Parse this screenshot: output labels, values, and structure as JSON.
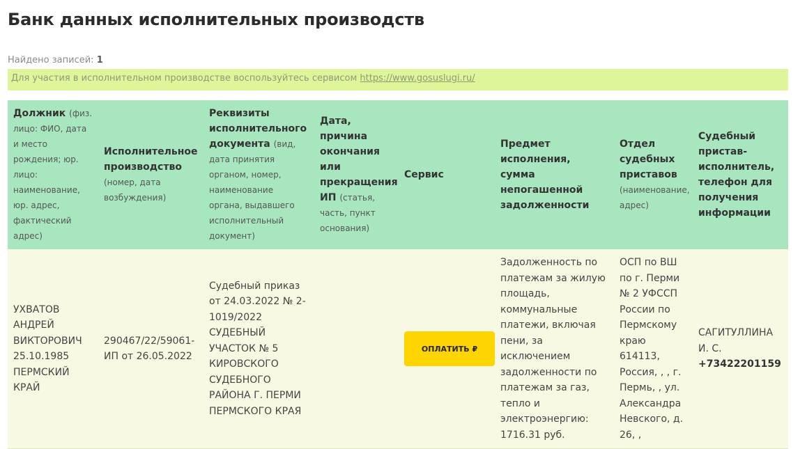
{
  "page": {
    "title": "Банк данных исполнительных производств"
  },
  "results": {
    "found_label": "Найдено записей:",
    "found_count": "1"
  },
  "notice": {
    "text": "Для участия в исполнительном производстве воспользуйтесь сервисом",
    "link": "https://www.gosuslugi.ru/"
  },
  "table": {
    "headers": [
      {
        "title": "Должник",
        "sub": "(физ. лицо: ФИО, дата и место рождения; юр. лицо: наименование, юр. адрес, фактический адрес)"
      },
      {
        "title": "Исполнительное производство",
        "sub": "(номер, дата возбуждения)"
      },
      {
        "title": "Реквизиты исполнительного документа",
        "sub": "(вид, дата принятия органом, номер, наименование органа, выдавшего исполнительный документ)"
      },
      {
        "title": "Дата, причина окончания или прекращения ИП",
        "sub": "(статья, часть, пункт основания)"
      },
      {
        "title": "Сервис",
        "sub": ""
      },
      {
        "title": "Предмет исполнения, сумма непогашенной задолженности",
        "sub": ""
      },
      {
        "title": "Отдел судебных приставов",
        "sub": "(наименование, адрес)"
      },
      {
        "title": "Судебный пристав-исполнитель, телефон для получения информации",
        "sub": ""
      }
    ],
    "row": {
      "debtor": "УХВАТОВ АНДРЕЙ ВИКТОРОВИЧ 25.10.1985 ПЕРМСКИЙ КРАЙ",
      "proceeding": "290467/22/59061-ИП от 26.05.2022",
      "document": "Судебный приказ от 24.03.2022 № 2-1019/2022 СУДЕБНЫЙ УЧАСТОК № 5 КИРОВСКОГО СУДЕБНОГО РАЙОНА Г. ПЕРМИ ПЕРМСКОГО КРАЯ",
      "end_reason": "",
      "pay_button": "ОПЛАТИТЬ ₽",
      "subject": "Задолженность по платежам за жилую площадь, коммунальные платежи, включая пени, за исключением задолженности по платежам за газ, тепло и электроэнергию: 1716.31 руб.",
      "department": "ОСП по ВШ по г. Перми № 2 УФССП России по Пермскому краю 614113, Россия, , , г. Пермь, , ул. Александра Невского, д. 26, ,",
      "bailiff": "САГИТУЛЛИНА И. С.",
      "phone": "+73422201159"
    }
  },
  "colors": {
    "header_bg": "#a8e6bf",
    "row_bg": "#f7f9e3",
    "notice_bg": "#dff599",
    "button_bg": "#ffd500"
  }
}
